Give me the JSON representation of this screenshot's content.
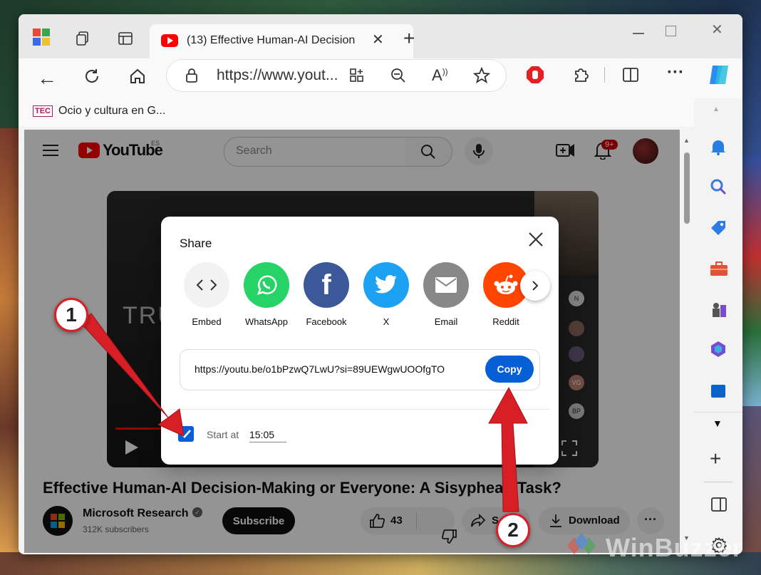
{
  "browser": {
    "tab_title": "(13) Effective Human-AI Decision",
    "address": "https://www.yout...",
    "favorite": "Ocio y cultura en G...",
    "favorite_icon_text": "TEC"
  },
  "youtube": {
    "logo_text": "YouTube",
    "region": "ES",
    "search_placeholder": "Search",
    "notification_count": "9+",
    "video_title": "Effective Human-AI Decision-Making or Everyone: A Sisyphean Task?",
    "video_overlay_text": "TRUS",
    "channel_name": "Microsoft Research",
    "subscribers": "312K subscribers",
    "subscribe_label": "Subscribe",
    "like_count": "43",
    "share_label": "S",
    "download_label": "Download",
    "participants": [
      "N",
      "VG",
      "BP"
    ]
  },
  "share_dialog": {
    "title": "Share",
    "options": [
      {
        "label": "Embed",
        "icon": "embed-icon",
        "color": "#f2f2f2"
      },
      {
        "label": "WhatsApp",
        "icon": "whatsapp-icon",
        "color": "#25d366"
      },
      {
        "label": "Facebook",
        "icon": "facebook-icon",
        "color": "#3b5998"
      },
      {
        "label": "X",
        "icon": "twitter-icon",
        "color": "#1da1f2"
      },
      {
        "label": "Email",
        "icon": "email-icon",
        "color": "#888888"
      },
      {
        "label": "Reddit",
        "icon": "reddit-icon",
        "color": "#ff4500"
      }
    ],
    "url": "https://youtu.be/o1bPzwQ7LwU?si=89UEWgwUOOfgTO",
    "copy_label": "Copy",
    "start_at_label": "Start at",
    "start_at_value": "15:05",
    "start_checked": true
  },
  "annotations": {
    "badge1": "1",
    "badge2": "2",
    "color": "#d81f26"
  },
  "watermark": "WinBuzzer"
}
